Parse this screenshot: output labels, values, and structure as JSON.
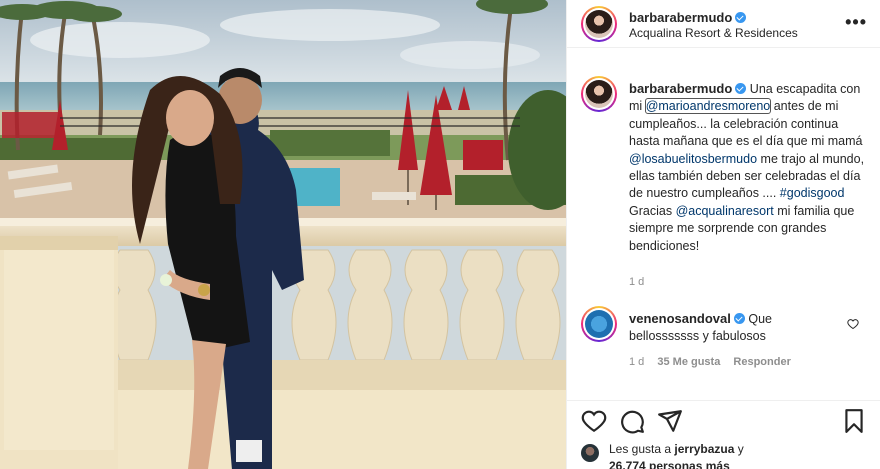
{
  "post": {
    "author": "barbarabermudo",
    "location": "Acqualina Resort & Residences",
    "more_label": "•••"
  },
  "caption": {
    "author": "barbarabermudo",
    "t1": "Una escapadita con mi",
    "m1": "@marioandresmoreno",
    "t2": "antes de mi cumpleaños... la celebración continua hasta mañana que es el día que mi mamá",
    "m2": "@losabuelitosbermudo",
    "t3": "me trajo al mundo, ellas también deben ser celebradas el día de nuestro cumpleaños ....",
    "m3": "#godisgood",
    "t4": "Gracias",
    "m4": "@acqualinaresort",
    "t5": "mi familia que siempre me sorprende con grandes bendiciones!",
    "time": "1 d"
  },
  "comment": {
    "author": "venenosandoval",
    "text": "Que bellosssssss y fabulosos",
    "time": "1 d",
    "likes": "35 Me gusta",
    "reply": "Responder"
  },
  "likes": {
    "prefix": "Les gusta a",
    "user": "jerrybazua",
    "conj": "y",
    "count": "26.774 personas más"
  },
  "icons": {
    "like": "heart-icon",
    "comment": "comment-icon",
    "share": "send-icon",
    "save": "bookmark-icon"
  },
  "colors": {
    "verified": "#3897f0",
    "mention": "#00376b",
    "muted": "#8e8e8e"
  }
}
